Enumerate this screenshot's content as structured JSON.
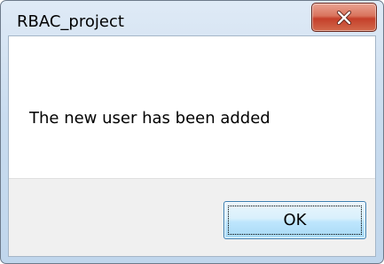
{
  "window": {
    "title": "RBAC_project"
  },
  "titlebar": {
    "close_icon": "close-x-icon",
    "close_color": "#c94a32"
  },
  "dialog": {
    "message": "The new user has been added",
    "ok_label": "OK"
  }
}
